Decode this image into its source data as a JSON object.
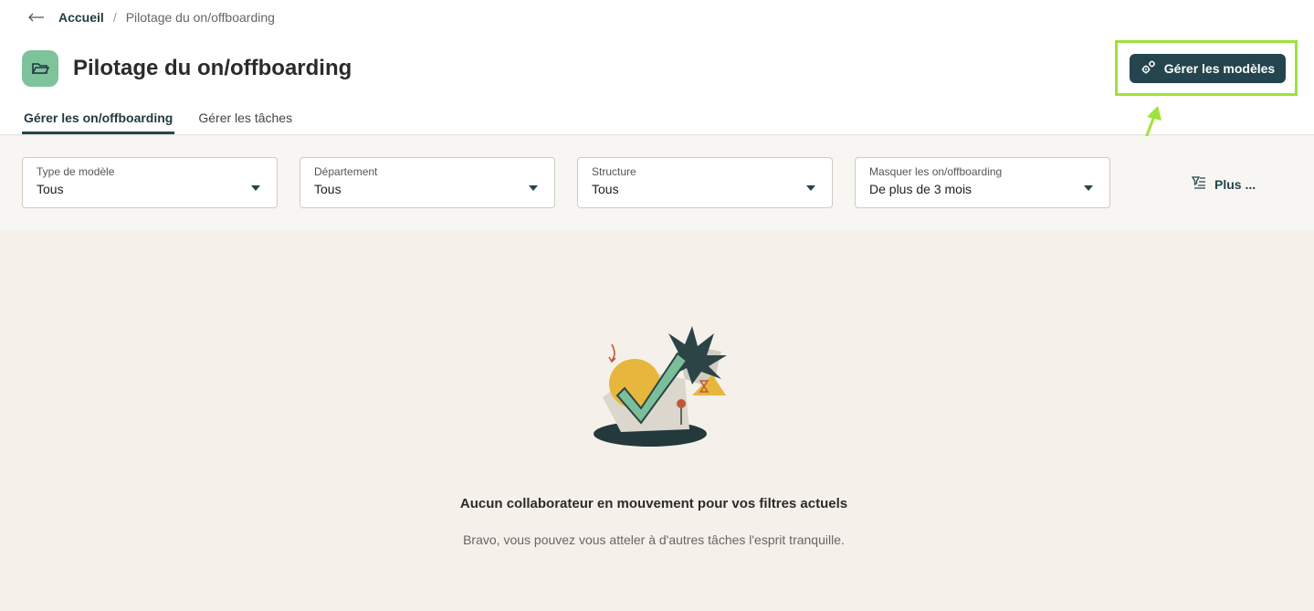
{
  "breadcrumb": {
    "back_icon": "arrow-left-icon",
    "home": "Accueil",
    "separator": "/",
    "current": "Pilotage du on/offboarding"
  },
  "header": {
    "title": "Pilotage du on/offboarding",
    "icon": "folder-icon",
    "icon_bg": "#7ec39b"
  },
  "actions": {
    "manage_templates_label": "Gérer les modèles",
    "manage_templates_icon": "gears-icon",
    "button_color": "#24454d",
    "highlight_color": "#9ee33a"
  },
  "tabs": [
    {
      "label": "Gérer les on/offboarding",
      "active": true
    },
    {
      "label": "Gérer les tâches",
      "active": false
    }
  ],
  "filters": [
    {
      "label": "Type de modèle",
      "value": "Tous"
    },
    {
      "label": "Département",
      "value": "Tous"
    },
    {
      "label": "Structure",
      "value": "Tous"
    },
    {
      "label": "Masquer les on/offboarding",
      "value": "De plus de 3 mois"
    }
  ],
  "more_filters": {
    "label": "Plus ...",
    "icon": "filter-list-icon"
  },
  "empty_state": {
    "illustration": "checkmark-plant-illustration",
    "title": "Aucun collaborateur en mouvement pour vos filtres actuels",
    "subtitle": "Bravo, vous pouvez vous atteler à d'autres tâches l'esprit tranquille."
  }
}
